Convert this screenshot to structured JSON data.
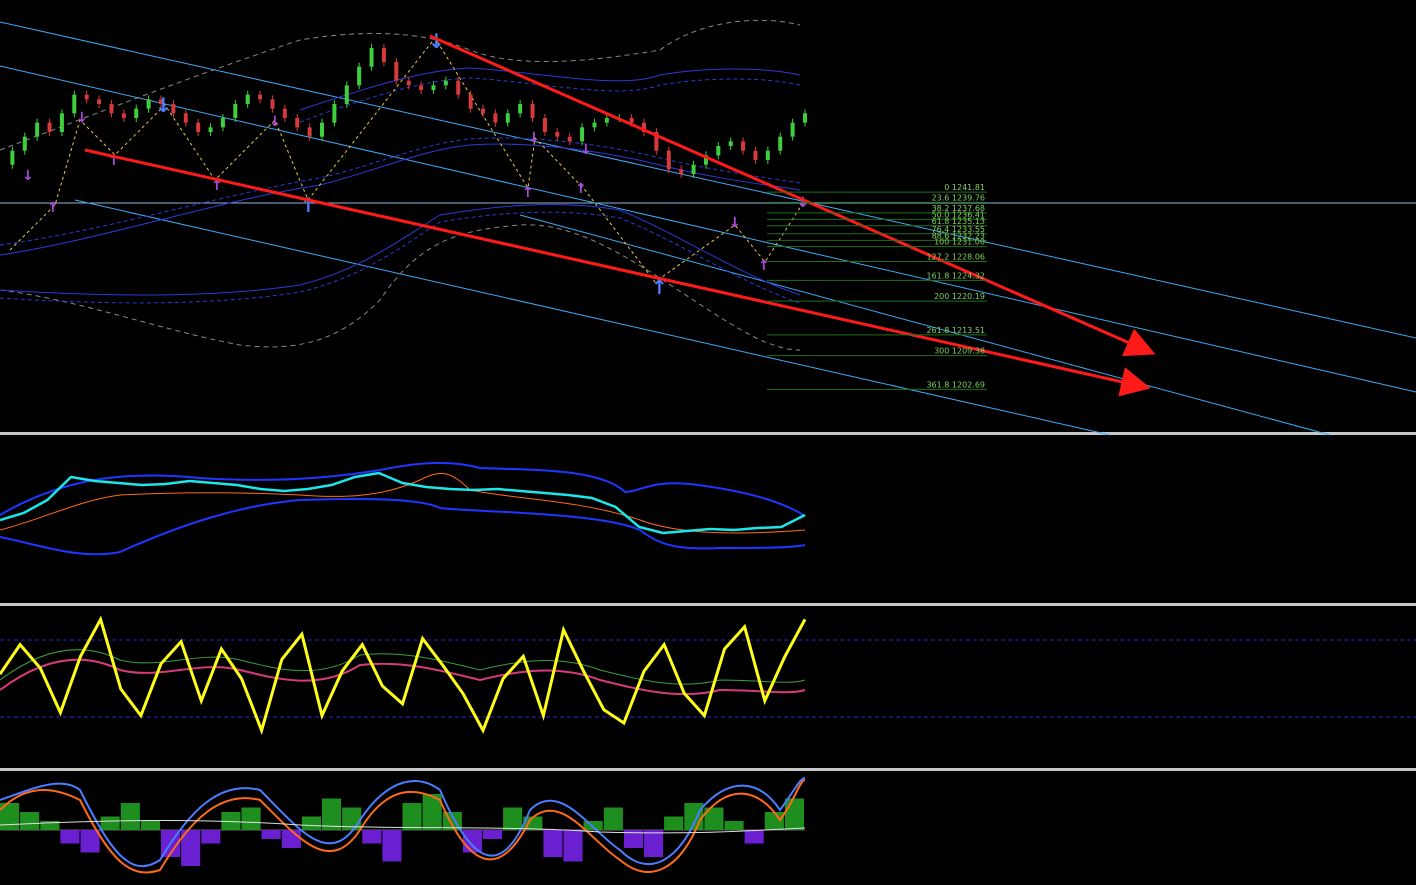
{
  "chart_data": [
    {
      "type": "candlestick",
      "panel": "main",
      "title": "",
      "fibonacci_levels": [
        {
          "ratio": "0",
          "price": "1241.81",
          "value": 1241.81
        },
        {
          "ratio": "23.6",
          "price": "1239.76",
          "value": 1239.76
        },
        {
          "ratio": "38.2",
          "price": "1237.68",
          "value": 1237.68
        },
        {
          "ratio": "50.0",
          "price": "1236.41",
          "value": 1236.41
        },
        {
          "ratio": "61.8",
          "price": "1235.13",
          "value": 1235.13
        },
        {
          "ratio": "76.4",
          "price": "1233.55",
          "value": 1233.55
        },
        {
          "ratio": "88.6",
          "price": "1232.23",
          "value": 1232.23
        },
        {
          "ratio": "100",
          "price": "1231.00",
          "value": 1231.0
        },
        {
          "ratio": "127.2",
          "price": "1228.06",
          "value": 1228.06
        },
        {
          "ratio": "161.8",
          "price": "1224.32",
          "value": 1224.32
        },
        {
          "ratio": "200",
          "price": "1220.19",
          "value": 1220.19
        },
        {
          "ratio": "261.8",
          "price": "1213.51",
          "value": 1213.51
        },
        {
          "ratio": "300",
          "price": "1209.38",
          "value": 1209.38
        },
        {
          "ratio": "361.8",
          "price": "1202.69",
          "value": 1202.69
        }
      ],
      "price_close_series": [
        1229,
        1232,
        1235,
        1238,
        1236,
        1240,
        1244,
        1243,
        1242,
        1240,
        1239,
        1241,
        1243,
        1242,
        1240,
        1238,
        1236,
        1237,
        1239,
        1242,
        1244,
        1243,
        1241,
        1239,
        1237,
        1235,
        1238,
        1242,
        1246,
        1250,
        1254,
        1251,
        1247,
        1246,
        1245,
        1246,
        1247,
        1244,
        1241,
        1240,
        1238,
        1240,
        1242,
        1239,
        1236,
        1235,
        1234,
        1237,
        1238,
        1239,
        1239,
        1238,
        1236,
        1232,
        1228,
        1227,
        1229,
        1231,
        1233,
        1234,
        1232,
        1230,
        1232,
        1235,
        1238,
        1240
      ],
      "colors": {
        "bull": "#3ecf3e",
        "bear": "#d63a3a",
        "trend_arrows": "#ff1a1a",
        "channel": "#3fa9f5"
      }
    },
    {
      "type": "line",
      "panel": "indicator-1",
      "series": [
        {
          "values": [
            0.35,
            0.42,
            0.55,
            0.78,
            0.74,
            0.72,
            0.7,
            0.71,
            0.74,
            0.72,
            0.7,
            0.66,
            0.64,
            0.66,
            0.7,
            0.78,
            0.82,
            0.72,
            0.68,
            0.66,
            0.65,
            0.66,
            0.64,
            0.62,
            0.6,
            0.57,
            0.48,
            0.28,
            0.22,
            0.24,
            0.26,
            0.25,
            0.27,
            0.28,
            0.4
          ]
        }
      ],
      "colors": {
        "main": "#1ce6ea",
        "bands": "#1e36ff",
        "ma": "#ff6a1a"
      }
    },
    {
      "type": "line",
      "panel": "indicator-2",
      "levels": [
        70,
        30
      ],
      "series": [
        {
          "values": [
            58,
            78,
            62,
            32,
            70,
            95,
            48,
            30,
            65,
            80,
            40,
            75,
            55,
            20,
            68,
            85,
            30,
            60,
            78,
            50,
            38,
            82,
            64,
            45,
            20,
            55,
            70,
            30,
            88,
            60,
            34,
            25,
            60,
            78,
            45,
            30,
            75,
            90,
            40,
            70,
            95
          ]
        }
      ],
      "colors": {
        "main": "#ffff1a",
        "aux": "#d63a7a",
        "level": "#2828c8"
      }
    },
    {
      "type": "bar",
      "panel": "indicator-3",
      "values": [
        0.6,
        0.4,
        0.2,
        -0.3,
        -0.5,
        0.3,
        0.6,
        0.2,
        -0.6,
        -0.8,
        -0.3,
        0.4,
        0.5,
        -0.2,
        -0.4,
        0.3,
        0.7,
        0.5,
        -0.3,
        -0.7,
        0.6,
        0.8,
        0.4,
        -0.5,
        -0.2,
        0.5,
        0.3,
        -0.6,
        -0.7,
        0.2,
        0.5,
        -0.4,
        -0.6,
        0.3,
        0.6,
        0.5,
        0.2,
        -0.3,
        0.4,
        0.7
      ],
      "colors": {
        "positive": "#1e8f1e",
        "negative": "#6a1fd1",
        "line1": "#ff6a1a",
        "line2": "#4a7dff"
      }
    }
  ]
}
